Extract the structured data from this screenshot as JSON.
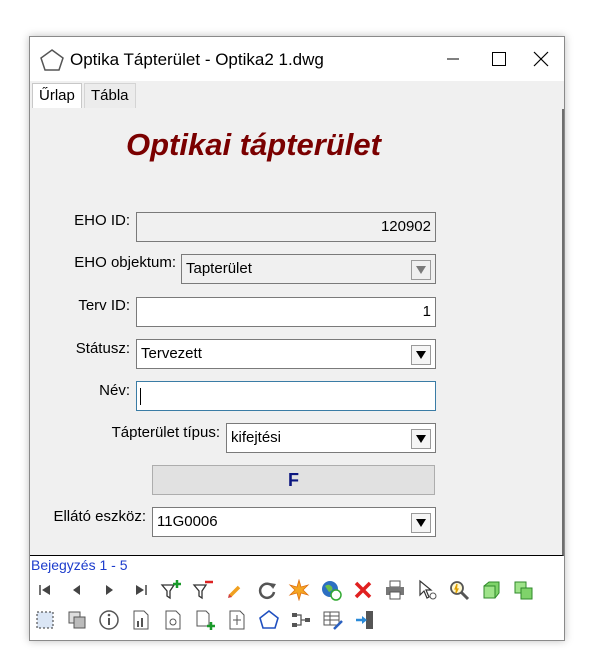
{
  "window": {
    "title": "Optika Tápterület - Optika2 1.dwg"
  },
  "tabs": [
    {
      "label": "Űrlap",
      "active": true
    },
    {
      "label": "Tábla",
      "active": false
    }
  ],
  "form": {
    "title": "Optikai tápterület",
    "eho_id": {
      "label": "EHO ID:",
      "value": "120902"
    },
    "eho_objektum": {
      "label": "EHO objektum:",
      "value": "Tapterület"
    },
    "terv_id": {
      "label": "Terv ID:",
      "value": "1"
    },
    "statusz": {
      "label": "Státusz:",
      "value": "Tervezett"
    },
    "nev": {
      "label": "Név:",
      "value": ""
    },
    "tapterulet_tipus": {
      "label": "Tápterület típus:",
      "value": "kifejtési"
    },
    "f_button": "F",
    "ellato_eszkoz": {
      "label": "Ellátó eszköz:",
      "value": "11G0006"
    }
  },
  "status": {
    "record_text": "Bejegyzés 1 - 5"
  },
  "colors": {
    "title": "#7a0000",
    "f_button_text": "#0b1680",
    "status_text": "#1c3ccc"
  },
  "toolbar": {
    "row1": [
      "first-record-icon",
      "previous-record-icon",
      "next-record-icon",
      "last-record-icon",
      "add-filter-icon",
      "remove-filter-icon",
      "edit-pencil-icon",
      "refresh-icon",
      "highlight-star-icon",
      "globe-refresh-icon",
      "delete-icon",
      "print-icon",
      "select-pointer-icon",
      "zoom-icon",
      "green-cube-icon",
      "green-cubes-icon"
    ],
    "row2": [
      "dashed-select-icon",
      "copy-shapes-icon",
      "info-icon",
      "chart-document-icon",
      "document-icon",
      "add-document-icon",
      "document-tree-icon",
      "pentagon-icon",
      "connection-icon",
      "table-edit-icon",
      "exit-icon"
    ]
  }
}
